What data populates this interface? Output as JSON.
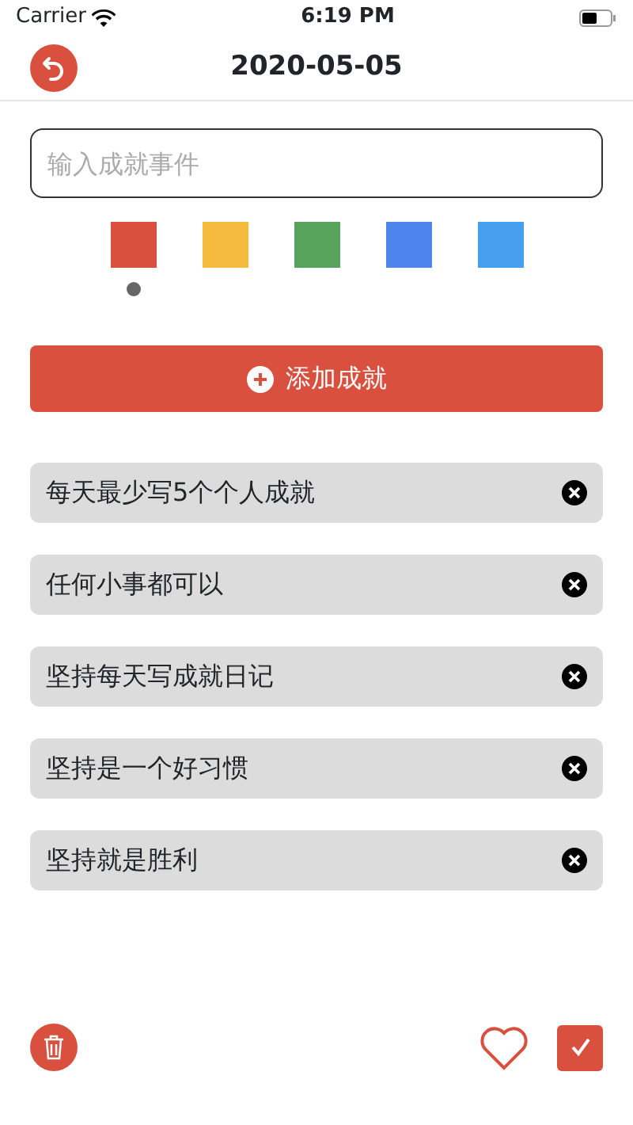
{
  "status_bar": {
    "carrier": "Carrier",
    "time": "6:19 PM"
  },
  "nav": {
    "title": "2020-05-05"
  },
  "input": {
    "placeholder": "输入成就事件"
  },
  "colors": [
    {
      "color": "#d9503f",
      "selected": true
    },
    {
      "color": "#f4bb3f",
      "selected": false
    },
    {
      "color": "#57a35c",
      "selected": false
    },
    {
      "color": "#4f84ec",
      "selected": false
    },
    {
      "color": "#46a0ef",
      "selected": false
    }
  ],
  "add_button": {
    "label": "添加成就"
  },
  "items": [
    {
      "text": "每天最少写5个个人成就"
    },
    {
      "text": "任何小事都可以"
    },
    {
      "text": "坚持每天写成就日记"
    },
    {
      "text": "坚持是一个好习惯"
    },
    {
      "text": "坚持就是胜利"
    }
  ]
}
